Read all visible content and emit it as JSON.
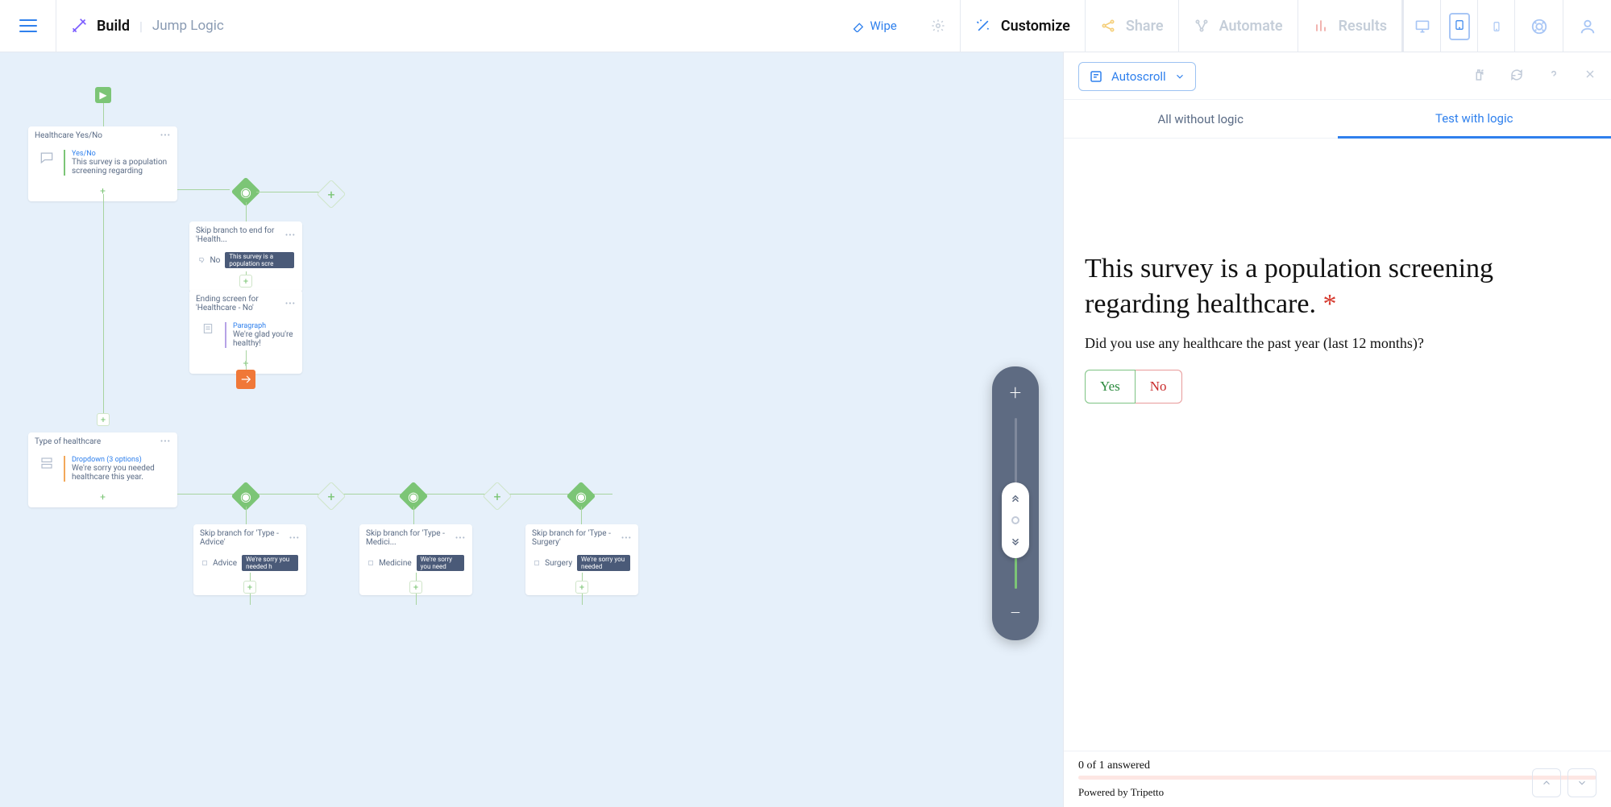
{
  "topbar": {
    "build": "Build",
    "jump_logic": "Jump Logic",
    "wipe": "Wipe",
    "customize": "Customize",
    "share": "Share",
    "automate": "Automate",
    "results": "Results"
  },
  "canvas": {
    "nodes": {
      "healthcare": {
        "title": "Healthcare Yes/No",
        "type": "Yes/No",
        "text": "This survey is a population screening regarding"
      },
      "skip_health": {
        "title": "Skip branch to end for 'Health...",
        "label": "No",
        "badge": "This survey is a population scre"
      },
      "ending_no": {
        "title": "Ending screen for 'Healthcare - No'",
        "type": "Paragraph",
        "text": "We're glad you're healthy!"
      },
      "type_hc": {
        "title": "Type of healthcare",
        "type": "Dropdown (3 options)",
        "text": "We're sorry you needed healthcare this year."
      },
      "branch_advice": {
        "title": "Skip branch for 'Type - Advice'",
        "label": "Advice",
        "badge": "We're sorry you needed h"
      },
      "branch_medicine": {
        "title": "Skip branch for 'Type - Medici...",
        "label": "Medicine",
        "badge": "We're sorry you need"
      },
      "branch_surgery": {
        "title": "Skip branch for 'Type - Surgery'",
        "label": "Surgery",
        "badge": "We're sorry you needed"
      }
    }
  },
  "preview": {
    "autoscroll": "Autoscroll",
    "tab_all": "All without logic",
    "tab_test": "Test with logic",
    "question_title": "This survey is a population screening regarding healthcare.",
    "question_sub": "Did you use any healthcare the past year (last 12 months)?",
    "yes": "Yes",
    "no": "No",
    "progress": "0 of 1 answered",
    "powered": "Powered by Tripetto"
  }
}
